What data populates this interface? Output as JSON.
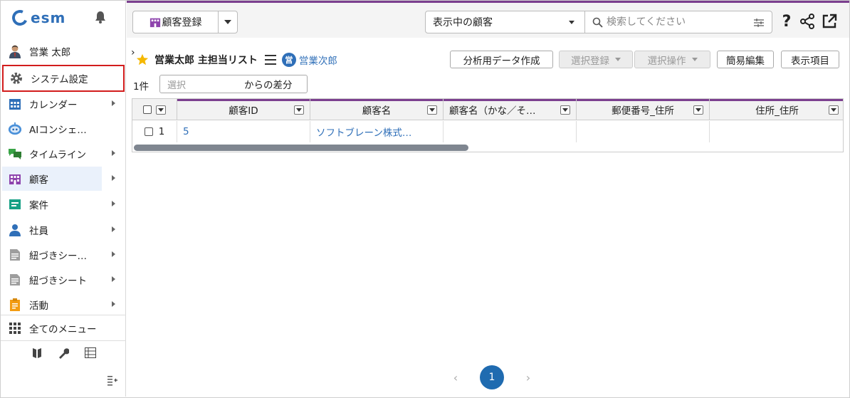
{
  "app": {
    "logo_text": "esm"
  },
  "sidebar": {
    "user_name": "営業 太郎",
    "items": [
      {
        "label": "システム設定",
        "icon": "gear-icon"
      },
      {
        "label": "カレンダー",
        "icon": "calendar-icon"
      },
      {
        "label": "AIコンシェ…",
        "icon": "ai-robot-icon"
      },
      {
        "label": "タイムライン",
        "icon": "chat-bubbles-icon"
      },
      {
        "label": "顧客",
        "icon": "building-icon"
      },
      {
        "label": "案件",
        "icon": "deal-card-icon"
      },
      {
        "label": "社員",
        "icon": "person-icon"
      },
      {
        "label": "紐づきシー…",
        "icon": "sheet-icon"
      },
      {
        "label": "紐づきシート",
        "icon": "sheet-icon"
      },
      {
        "label": "活動",
        "icon": "clipboard-icon"
      }
    ],
    "all_menu": "全てのメニュー"
  },
  "topbar": {
    "register_label": "顧客登録",
    "view_select": "表示中の顧客",
    "search_placeholder": "検索してください",
    "help_glyph": "?"
  },
  "list": {
    "title": "営業太郎 主担当リスト",
    "owner_badge": "営",
    "owner_name": "営業次郎",
    "buttons": {
      "analytics": "分析用データ作成",
      "select_register": "選択登録",
      "select_ops": "選択操作",
      "quick_edit": "簡易編集",
      "display_items": "表示項目"
    },
    "count": "1件",
    "diff_placeholder": "選択",
    "diff_label": "からの差分"
  },
  "table": {
    "columns": [
      "顧客ID",
      "顧客名",
      "顧客名（かな／そ…",
      "郵便番号_住所",
      "住所_住所"
    ],
    "rows": [
      {
        "index": "1",
        "id": "5",
        "name": "ソフトブレーン株式…",
        "kana": "",
        "zip": "",
        "address": ""
      }
    ]
  },
  "pagination": {
    "current": "1",
    "prev": "‹",
    "next": "›"
  },
  "colors": {
    "accent": "#7b3f8f",
    "link": "#2f6fb8",
    "highlight": "#d21d1d",
    "page_active": "#1f6bb0"
  }
}
